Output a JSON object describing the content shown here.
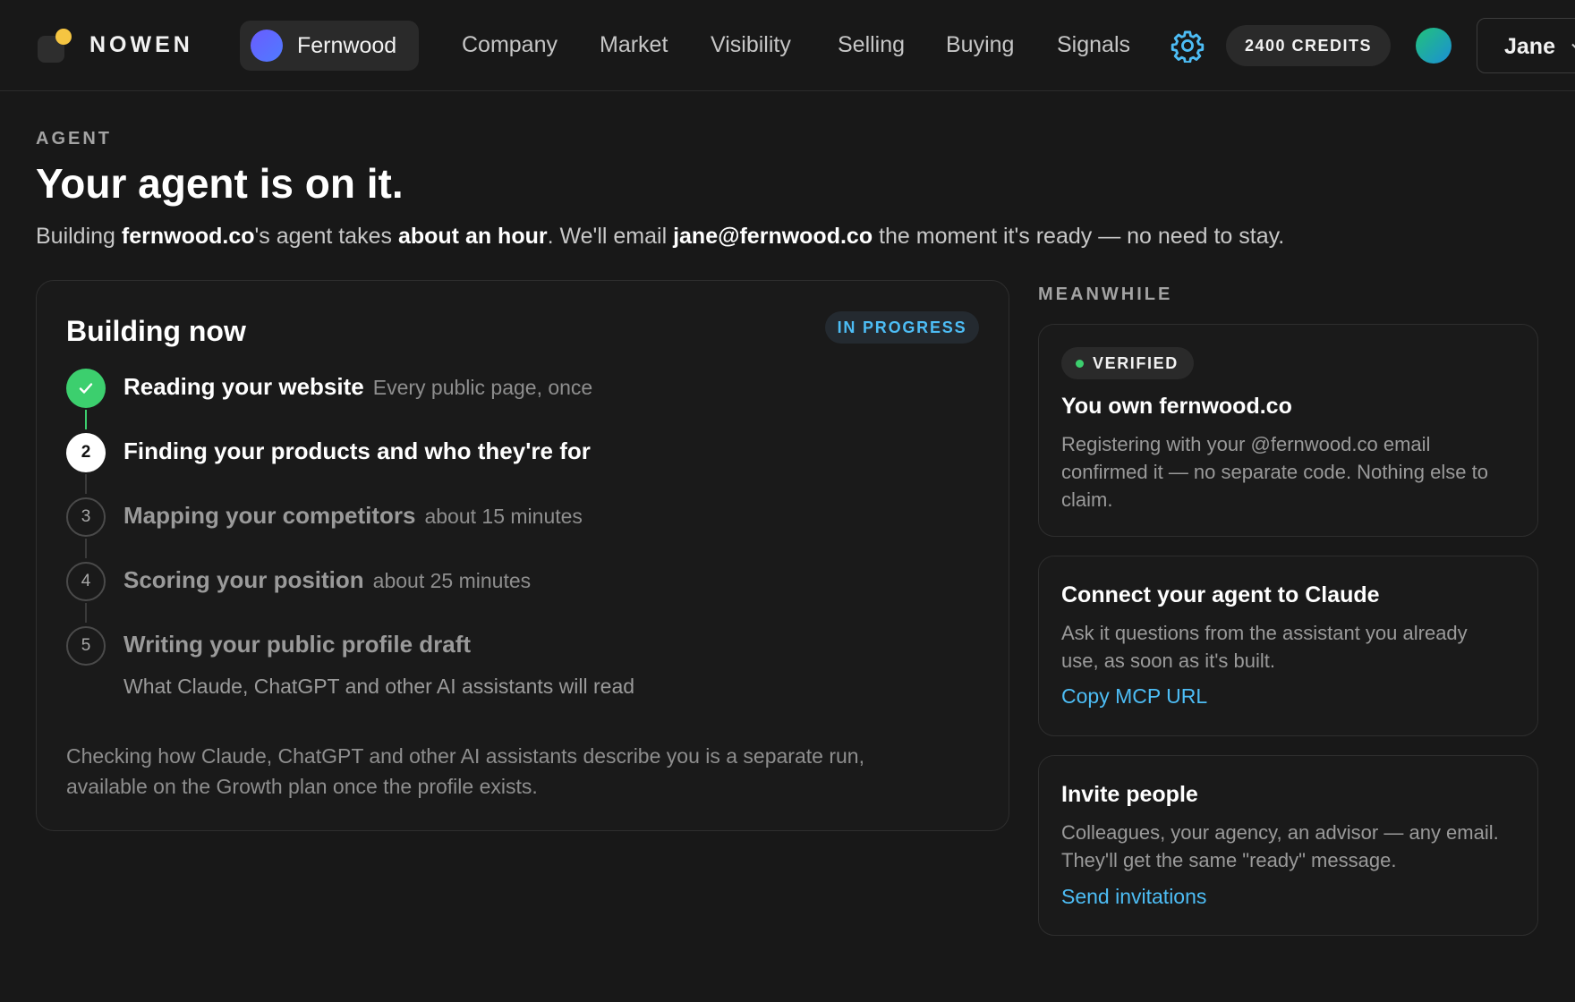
{
  "brand": {
    "name": "NOWEN"
  },
  "workspace": {
    "name": "Fernwood"
  },
  "nav": {
    "items": [
      "Company",
      "Market",
      "Visibility",
      "Selling",
      "Buying",
      "Signals"
    ]
  },
  "credits": {
    "label": "2400 CREDITS"
  },
  "user": {
    "name": "Jane"
  },
  "header": {
    "eyebrow": "AGENT",
    "title": "Your agent is on it.",
    "sub_1": "Building ",
    "sub_domain": "fernwood.co",
    "sub_2": "'s agent takes ",
    "sub_duration": "about an hour",
    "sub_3": ". We'll email ",
    "sub_email": "jane@fernwood.co",
    "sub_4": " the moment it's ready — no need to stay."
  },
  "build": {
    "title": "Building now",
    "status": "IN PROGRESS",
    "steps": [
      {
        "number": "",
        "title": "Reading your website",
        "note": "Every public page, once",
        "state": "done"
      },
      {
        "number": "2",
        "title": "Finding your products and who they're for",
        "note": "",
        "state": "active"
      },
      {
        "number": "3",
        "title": "Mapping your competitors",
        "note": "about 15 minutes",
        "state": "pending"
      },
      {
        "number": "4",
        "title": "Scoring your position",
        "note": "about 25 minutes",
        "state": "pending"
      },
      {
        "number": "5",
        "title": "Writing your public profile draft",
        "note": "",
        "desc": "What Claude, ChatGPT and other AI assistants will read",
        "state": "pending"
      }
    ],
    "footnote": "Checking how Claude, ChatGPT and other AI assistants describe you is a separate run, available on the Growth plan once the profile exists."
  },
  "meanwhile": {
    "eyebrow": "MEANWHILE",
    "cards": [
      {
        "badge": "VERIFIED",
        "title": "You own fernwood.co",
        "body": "Registering with your @fernwood.co email confirmed it — no separate code. Nothing else to claim.",
        "link": ""
      },
      {
        "title": "Connect your agent to Claude",
        "body": "Ask it questions from the assistant you already use, as soon as it's built.",
        "link": "Copy MCP URL"
      },
      {
        "title": "Invite people",
        "body": "Colleagues, your agency, an advisor — any email. They'll get the same \"ready\" message.",
        "link": "Send invitations"
      }
    ]
  },
  "colors": {
    "accent": "#4dbdf5",
    "success": "#3ccf6e",
    "background": "#181818"
  }
}
